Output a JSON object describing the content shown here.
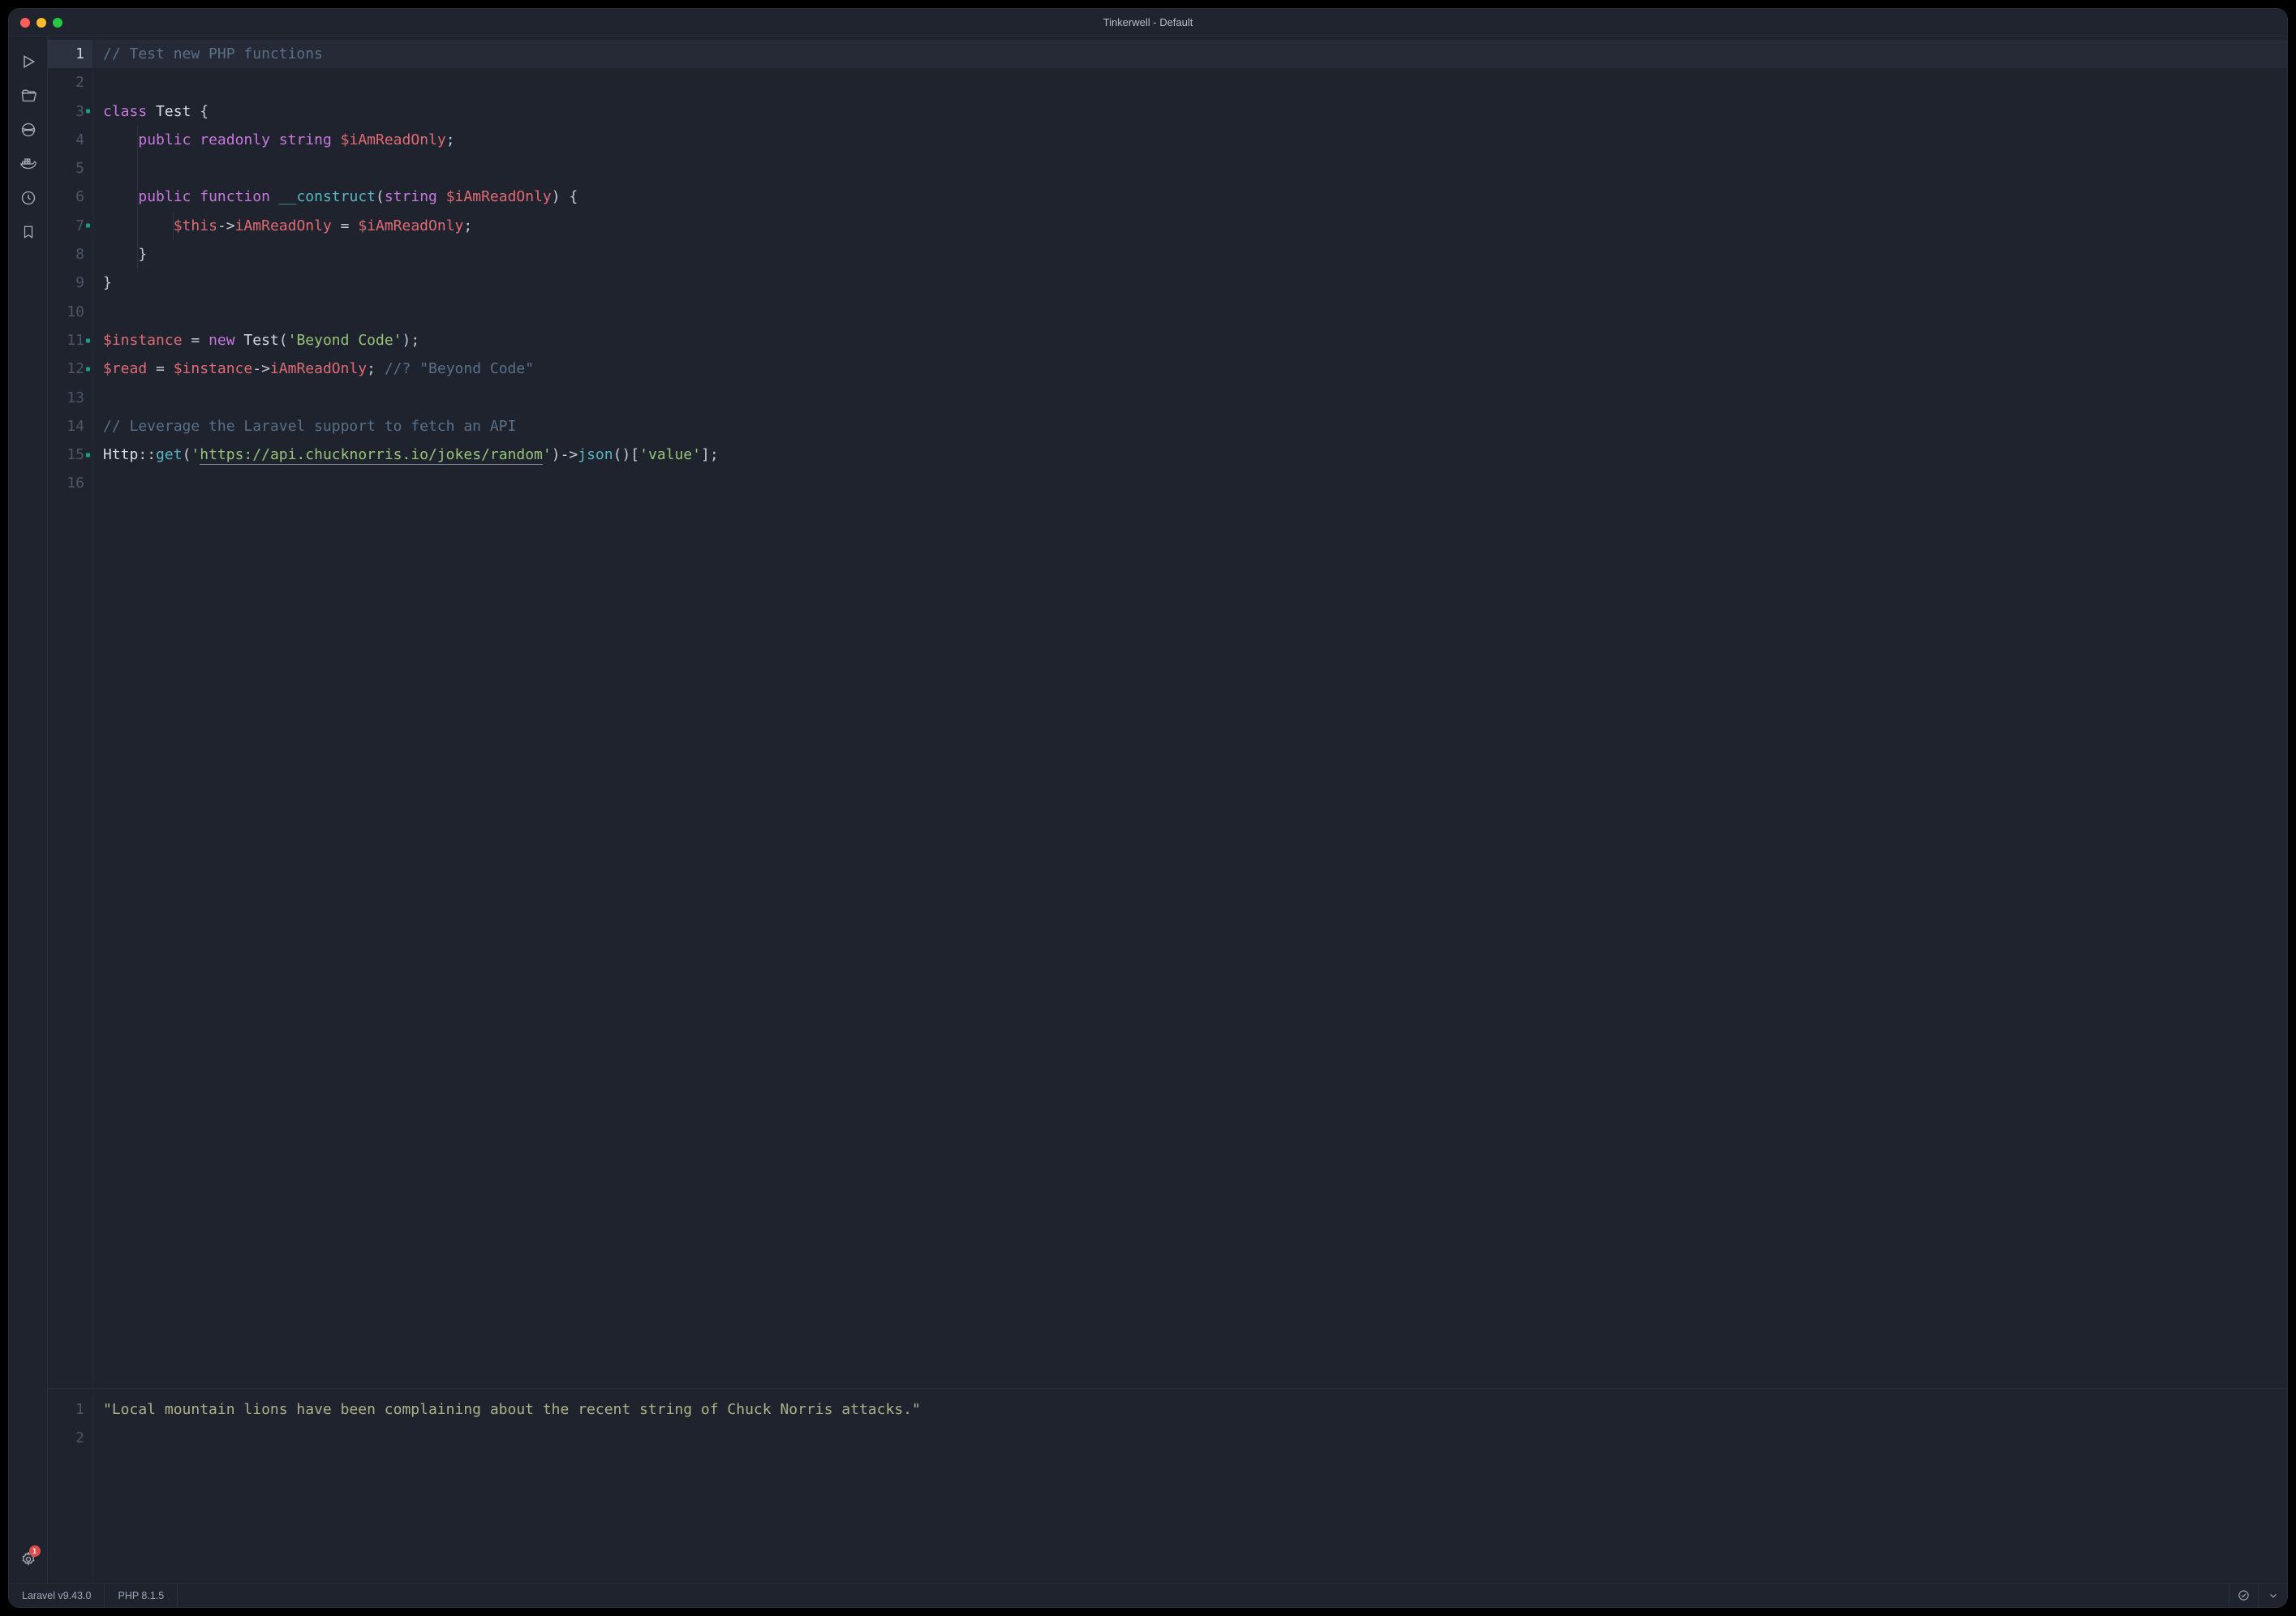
{
  "window": {
    "title": "Tinkerwell - Default"
  },
  "sidebar": {
    "items": [
      {
        "name": "run",
        "label": "Run"
      },
      {
        "name": "open",
        "label": "Open Folder"
      },
      {
        "name": "cloud",
        "label": "Cloud"
      },
      {
        "name": "docker",
        "label": "Docker"
      },
      {
        "name": "history",
        "label": "History"
      },
      {
        "name": "bookmark",
        "label": "Bookmarks"
      }
    ],
    "settings": {
      "label": "Settings",
      "badge": "1"
    }
  },
  "editor": {
    "current_line": 1,
    "lines": [
      {
        "n": 1,
        "fold": false,
        "tokens": [
          [
            "comment",
            "// Test new PHP functions"
          ]
        ]
      },
      {
        "n": 2,
        "fold": false,
        "tokens": []
      },
      {
        "n": 3,
        "fold": true,
        "tokens": [
          [
            "keyword",
            "class"
          ],
          [
            "punct",
            " "
          ],
          [
            "class",
            "Test"
          ],
          [
            "punct",
            " {"
          ]
        ]
      },
      {
        "n": 4,
        "fold": false,
        "indent": 1,
        "tokens": [
          [
            "modifier",
            "public"
          ],
          [
            "punct",
            " "
          ],
          [
            "modifier",
            "readonly"
          ],
          [
            "punct",
            " "
          ],
          [
            "type",
            "string"
          ],
          [
            "punct",
            " "
          ],
          [
            "var",
            "$iAmReadOnly"
          ],
          [
            "punct",
            ";"
          ]
        ]
      },
      {
        "n": 5,
        "fold": false,
        "indent": 1,
        "tokens": []
      },
      {
        "n": 6,
        "fold": false,
        "indent": 1,
        "tokens": [
          [
            "modifier",
            "public"
          ],
          [
            "punct",
            " "
          ],
          [
            "keyword",
            "function"
          ],
          [
            "punct",
            " "
          ],
          [
            "func",
            "__construct"
          ],
          [
            "punct",
            "("
          ],
          [
            "type",
            "string"
          ],
          [
            "punct",
            " "
          ],
          [
            "var",
            "$iAmReadOnly"
          ],
          [
            "punct",
            ") {"
          ]
        ]
      },
      {
        "n": 7,
        "fold": true,
        "indent": 2,
        "tokens": [
          [
            "var",
            "$this"
          ],
          [
            "punct",
            "->"
          ],
          [
            "prop",
            "iAmReadOnly"
          ],
          [
            "punct",
            " = "
          ],
          [
            "var",
            "$iAmReadOnly"
          ],
          [
            "punct",
            ";"
          ]
        ]
      },
      {
        "n": 8,
        "fold": false,
        "indent": 1,
        "tokens": [
          [
            "punct",
            "}"
          ]
        ]
      },
      {
        "n": 9,
        "fold": false,
        "tokens": [
          [
            "punct",
            "}"
          ]
        ]
      },
      {
        "n": 10,
        "fold": false,
        "tokens": []
      },
      {
        "n": 11,
        "fold": true,
        "tokens": [
          [
            "var",
            "$instance"
          ],
          [
            "punct",
            " = "
          ],
          [
            "keyword",
            "new"
          ],
          [
            "punct",
            " "
          ],
          [
            "class",
            "Test"
          ],
          [
            "punct",
            "("
          ],
          [
            "string",
            "'Beyond Code'"
          ],
          [
            "punct",
            ");"
          ]
        ]
      },
      {
        "n": 12,
        "fold": true,
        "tokens": [
          [
            "var",
            "$read"
          ],
          [
            "punct",
            " = "
          ],
          [
            "var",
            "$instance"
          ],
          [
            "punct",
            "->"
          ],
          [
            "prop",
            "iAmReadOnly"
          ],
          [
            "punct",
            "; "
          ],
          [
            "comment",
            "//? \"Beyond Code\""
          ]
        ]
      },
      {
        "n": 13,
        "fold": false,
        "tokens": []
      },
      {
        "n": 14,
        "fold": false,
        "tokens": [
          [
            "comment",
            "// Leverage the Laravel support to fetch an API"
          ]
        ]
      },
      {
        "n": 15,
        "fold": true,
        "tokens": [
          [
            "class",
            "Http"
          ],
          [
            "punct",
            "::"
          ],
          [
            "func",
            "get"
          ],
          [
            "punct",
            "("
          ],
          [
            "string",
            "'"
          ],
          [
            "string-u",
            "https://api.chucknorris.io/jokes/random"
          ],
          [
            "string",
            "'"
          ],
          [
            "punct",
            ")->"
          ],
          [
            "func",
            "json"
          ],
          [
            "punct",
            "()["
          ],
          [
            "string",
            "'value'"
          ],
          [
            "punct",
            "];"
          ]
        ]
      },
      {
        "n": 16,
        "fold": false,
        "tokens": []
      }
    ]
  },
  "output": {
    "lines": [
      {
        "n": 1,
        "text": "\"Local mountain lions have been complaining about the recent string of Chuck Norris attacks.\""
      },
      {
        "n": 2,
        "text": ""
      }
    ]
  },
  "statusbar": {
    "framework": "Laravel v9.43.0",
    "php": "PHP 8.1.5"
  }
}
